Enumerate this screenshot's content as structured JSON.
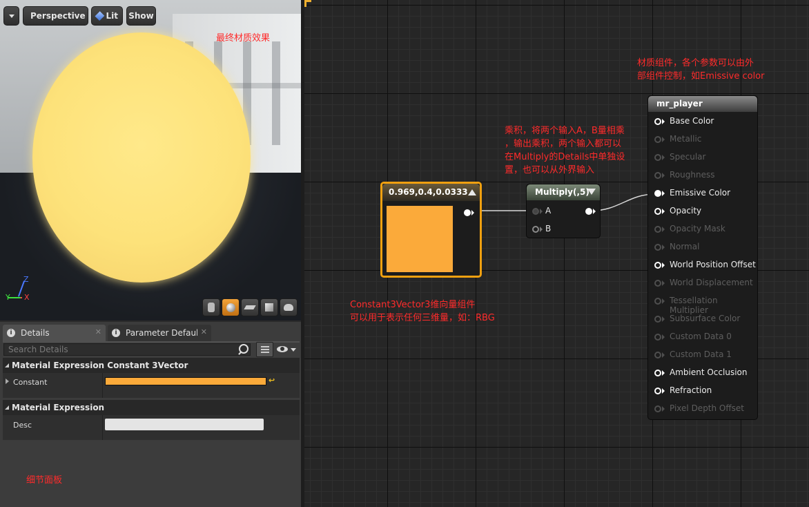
{
  "viewport": {
    "menu_icon": "chevron-down-icon",
    "view_mode_label": "Perspective",
    "lit_label": "Lit",
    "show_label": "Show",
    "annotation": "最终材质效果",
    "axis_z": "Z",
    "axis_y": "Y",
    "axis_x": "X"
  },
  "details": {
    "tabs": [
      {
        "label": "Details"
      },
      {
        "label": "Parameter Defaults"
      }
    ],
    "search_placeholder": "Search Details",
    "sections": [
      {
        "title": "Material Expression Constant 3Vector",
        "property_label": "Constant",
        "color": "#fbaa3a"
      },
      {
        "title": "Material Expression",
        "property_label": "Desc",
        "value": ""
      }
    ],
    "annotation": "细节面板"
  },
  "graph": {
    "constant_node": {
      "title": "0.969,0.4,0.0333",
      "color": "#fbaa3a"
    },
    "multiply_node": {
      "title": "Multiply(,5)",
      "inputs": [
        "A",
        "B"
      ]
    },
    "material_node": {
      "title": "mr_player",
      "pins": [
        {
          "label": "Base Color",
          "enabled": true
        },
        {
          "label": "Metallic",
          "enabled": false
        },
        {
          "label": "Specular",
          "enabled": false
        },
        {
          "label": "Roughness",
          "enabled": false
        },
        {
          "label": "Emissive Color",
          "enabled": true
        },
        {
          "label": "Opacity",
          "enabled": true
        },
        {
          "label": "Opacity Mask",
          "enabled": false
        },
        {
          "label": "Normal",
          "enabled": false
        },
        {
          "label": "World Position Offset",
          "enabled": true
        },
        {
          "label": "World Displacement",
          "enabled": false
        },
        {
          "label": "Tessellation Multiplier",
          "enabled": false
        },
        {
          "label": "Subsurface Color",
          "enabled": false
        },
        {
          "label": "Custom Data 0",
          "enabled": false
        },
        {
          "label": "Custom Data 1",
          "enabled": false
        },
        {
          "label": "Ambient Occlusion",
          "enabled": true
        },
        {
          "label": "Refraction",
          "enabled": true
        },
        {
          "label": "Pixel Depth Offset",
          "enabled": false
        }
      ]
    },
    "annotations": {
      "material": [
        "材质组件，各个参数可以由外",
        "部组件控制，如Emissive color"
      ],
      "multiply": [
        "乘积，将两个输入A，B量相乘",
        "，输出乘积，两个输入都可以",
        "在Multiply的Details中单独设",
        "置，也可以从外界输入"
      ],
      "constant": [
        "Constant3Vector3维向量组件",
        "可以用于表示任何三维量，如：RBG"
      ]
    }
  }
}
